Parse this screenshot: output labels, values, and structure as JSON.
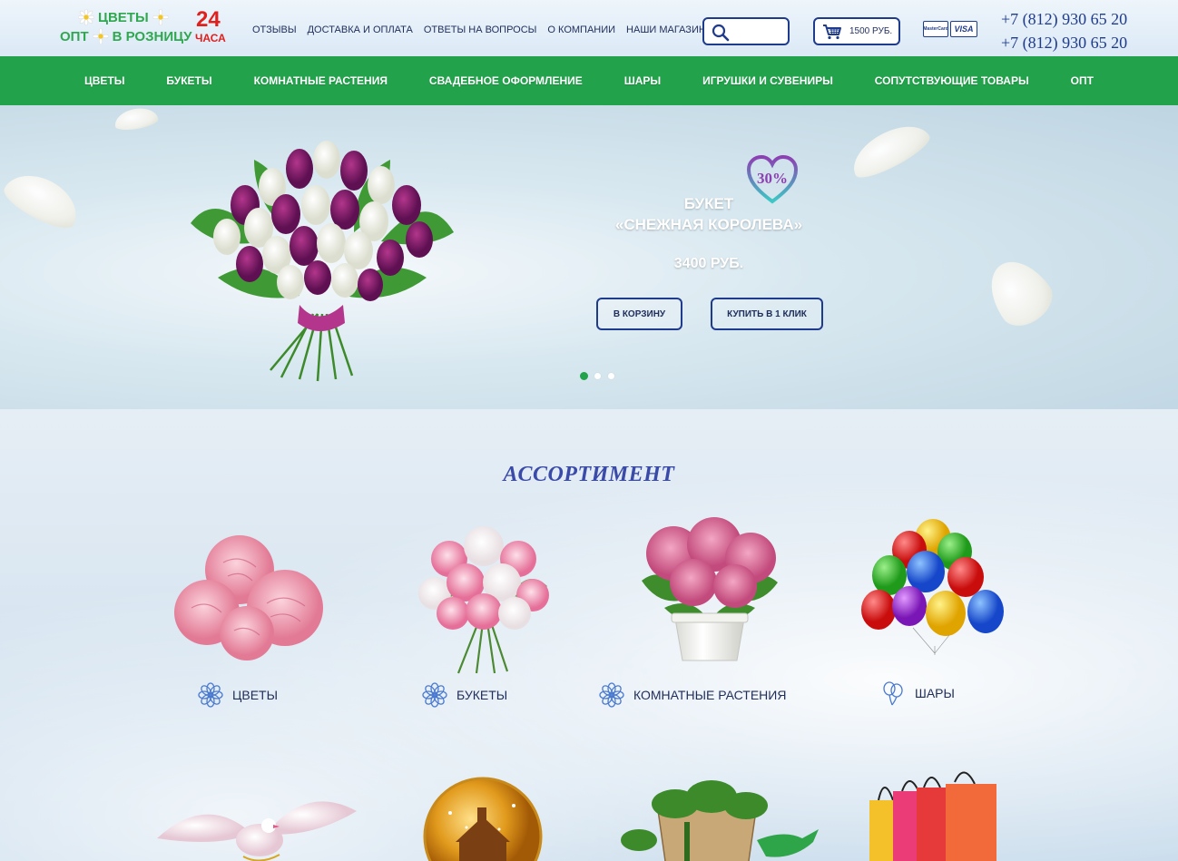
{
  "header": {
    "logo_line1": "ЦВЕТЫ",
    "logo_line2_left": "ОПТ",
    "logo_line2_right": "В РОЗНИЦУ",
    "logo_24": "24",
    "logo_hours": "ЧАСА",
    "top_links": [
      "ОТЗЫВЫ",
      "ДОСТАВКА И ОПЛАТА",
      "ОТВЕТЫ НА ВОПРОСЫ",
      "О КОМПАНИИ",
      "НАШИ МАГАЗИНЫ"
    ],
    "search_placeholder": "",
    "cart_total": "1500 РУБ.",
    "pay_mastercard": "MasterCard",
    "pay_visa": "VISA",
    "phone1": "+7 (812) 930 65 20",
    "phone2": "+7 (812) 930 65 20"
  },
  "nav": {
    "items": [
      "ЦВЕТЫ",
      "БУКЕТЫ",
      "КОМНАТНЫЕ РАСТЕНИЯ",
      "СВАДЕБНОЕ ОФОРМЛЕНИЕ",
      "ШАРЫ",
      "ИГРУШКИ И СУВЕНИРЫ",
      "СОПУТСТВУЮЩИЕ ТОВАРЫ",
      "ОПТ"
    ]
  },
  "hero": {
    "discount": "30%",
    "title_line1": "БУКЕТ",
    "title_line2": "«СНЕЖНАЯ КОРОЛЕВА»",
    "price": "3400 РУБ.",
    "btn_cart": "В КОРЗИНУ",
    "btn_oneclick": "КУПИТЬ В 1 КЛИК",
    "slides_total": 3,
    "active_slide": 1
  },
  "assortment": {
    "title": "АССОРТИМЕНТ",
    "categories": [
      {
        "label": "ЦВЕТЫ",
        "icon": "flower-icon"
      },
      {
        "label": "БУКЕТЫ",
        "icon": "flower-icon"
      },
      {
        "label": "КОМНАТНЫЕ РАСТЕНИЯ",
        "icon": "flower-icon"
      },
      {
        "label": "ШАРЫ",
        "icon": "balloons-icon"
      }
    ]
  },
  "colors": {
    "brand_green": "#22a24b",
    "accent_navy": "#1f3b8c",
    "logo_red": "#e0201d"
  }
}
